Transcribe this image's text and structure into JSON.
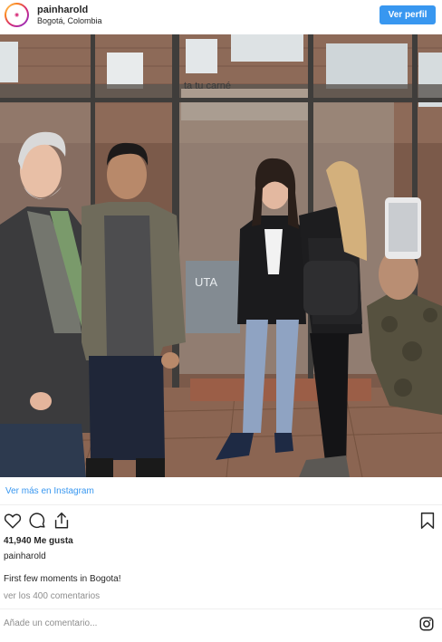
{
  "header": {
    "username": "painharold",
    "location": "Bogotá, Colombia",
    "profile_button": "Ver perfil",
    "avatar_icon": "painharold-avatar"
  },
  "photo": {
    "sign_text": "ta tu carné",
    "door_text": "UTA"
  },
  "links": {
    "view_more": "Ver más en Instagram"
  },
  "actions": {
    "like_icon": "heart-icon",
    "comment_icon": "comment-icon",
    "share_icon": "share-icon",
    "save_icon": "bookmark-icon"
  },
  "post": {
    "likes": "41,940 Me gusta",
    "owner": "painharold",
    "caption": "First few moments in Bogota!",
    "view_comments": "ver los 400 comentarios"
  },
  "comment": {
    "placeholder": "Añade un comentario...",
    "instagram_icon": "instagram-icon"
  },
  "colors": {
    "accent": "#3897f0",
    "muted": "#8e8e8e",
    "text": "#262626"
  }
}
